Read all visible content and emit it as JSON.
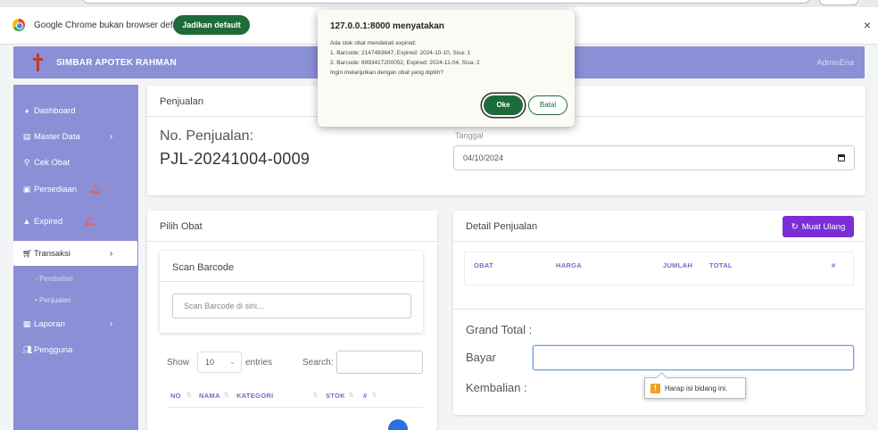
{
  "browser": {
    "infobar_text": "Google Chrome bukan browser default",
    "default_button": "Jadikan default",
    "close": "×"
  },
  "header": {
    "title": "SIMBAR APOTEK RAHMAN",
    "user": "AdminEna"
  },
  "sidebar": {
    "items": [
      {
        "label": "Dashboard"
      },
      {
        "label": "Master Data"
      },
      {
        "label": "Cek Obat"
      },
      {
        "label": "Persediaan",
        "badge": "1"
      },
      {
        "label": "Expired",
        "badge": "1"
      },
      {
        "label": "Transaksi"
      },
      {
        "label": "Laporan"
      },
      {
        "label": "Pengguna"
      }
    ],
    "sub_items": [
      "Pembelian",
      "Penjualan"
    ]
  },
  "penjualan": {
    "card_title": "Penjualan",
    "no_label": "No. Penjualan:",
    "no_value": "PJL-20241004-0009",
    "tanggal_label": "Tanggal",
    "tanggal_value": "04/10/2024"
  },
  "pilih_obat": {
    "title": "Pilih Obat",
    "scan_title": "Scan Barcode",
    "scan_placeholder": "Scan Barcode di sini...",
    "show_label": "Show",
    "show_value": "10",
    "entries_label": "entries",
    "search_label": "Search:",
    "columns": [
      "NO",
      "NAMA",
      "KATEGORI",
      "STOK",
      "#"
    ]
  },
  "detail": {
    "title": "Detail Penjualan",
    "reload_button": "Muat Ulang",
    "columns": [
      "OBAT",
      "HARGA",
      "JUMLAH",
      "TOTAL",
      "#"
    ],
    "grand_total_label": "Grand Total :",
    "bayar_label": "Bayar",
    "kembalian_label": "Kembalian :",
    "tooltip": "Harap isi bidang ini."
  },
  "dialog": {
    "title": "127.0.0.1:8000 menyatakan",
    "lines": [
      "Ada stok obat mendekati expired:",
      "1. Barcode: 2147483647, Expired: 2024-10-10, Sisa: 1",
      "2. Barcode: 8993417200052, Expired: 2024-11-04, Sisa: 2",
      "Ingin melanjutkan dengan obat yang dipilih?"
    ],
    "ok": "Oke",
    "cancel": "Batal"
  },
  "colors": {
    "sidebar": "#8b8fd6",
    "accent_purple": "#7b2ed6",
    "dialog_green": "#1e6b3a",
    "bell_red": "#ff4b4b"
  }
}
